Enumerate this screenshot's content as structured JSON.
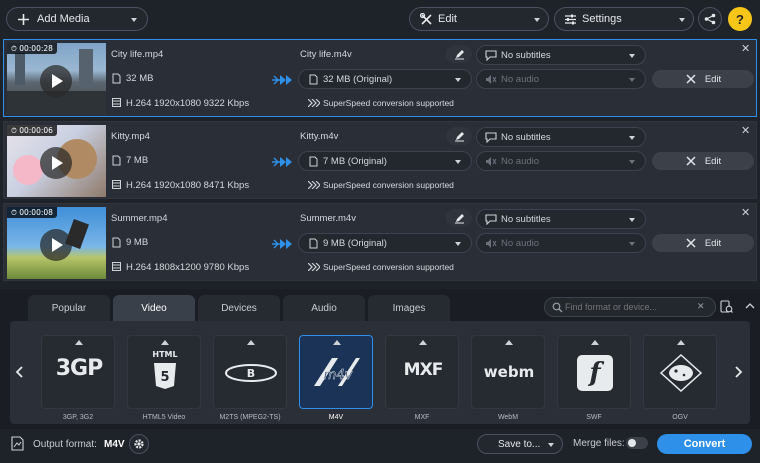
{
  "toolbar": {
    "add_media": "Add Media",
    "edit": "Edit",
    "settings": "Settings",
    "help": "?"
  },
  "files": [
    {
      "duration": "00:00:28",
      "source_name": "City life.mp4",
      "source_size": "32 MB",
      "source_info": "H.264 1920x1080 9322 Kbps",
      "output_name": "City life.m4v",
      "output_size": "32 MB (Original)",
      "superspeed": "SuperSpeed conversion supported",
      "subtitles": "No subtitles",
      "audio": "No audio",
      "edit": "Edit"
    },
    {
      "duration": "00:00:06",
      "source_name": "Kitty.mp4",
      "source_size": "7 MB",
      "source_info": "H.264 1920x1080 8471 Kbps",
      "output_name": "Kitty.m4v",
      "output_size": "7 MB (Original)",
      "superspeed": "SuperSpeed conversion supported",
      "subtitles": "No subtitles",
      "audio": "No audio",
      "edit": "Edit"
    },
    {
      "duration": "00:00:08",
      "source_name": "Summer.mp4",
      "source_size": "9 MB",
      "source_info": "H.264 1808x1200 9780 Kbps",
      "output_name": "Summer.m4v",
      "output_size": "9 MB (Original)",
      "superspeed": "SuperSpeed conversion supported",
      "subtitles": "No subtitles",
      "audio": "No audio",
      "edit": "Edit"
    }
  ],
  "tabs": [
    "Popular",
    "Video",
    "Devices",
    "Audio",
    "Images"
  ],
  "active_tab": "Video",
  "format_search": {
    "placeholder": "Find format or device..."
  },
  "formats": [
    {
      "logo": "3GP",
      "label": "3GP, 3G2"
    },
    {
      "logo": "HTML5",
      "label": "HTML5 Video"
    },
    {
      "logo": "Blu-ray",
      "label": "M2TS (MPEG2-TS)"
    },
    {
      "logo": "m4v",
      "label": "M4V"
    },
    {
      "logo": "MXF",
      "label": "MXF"
    },
    {
      "logo": "webm",
      "label": "WebM"
    },
    {
      "logo": "f",
      "label": "SWF"
    },
    {
      "logo": "OGV",
      "label": "OGV"
    }
  ],
  "selected_format": "M4V",
  "bottom": {
    "output_format_label": "Output format:",
    "output_format_value": "M4V",
    "save_to": "Save to...",
    "merge_files": "Merge files:",
    "convert": "Convert"
  },
  "colors": {
    "accent": "#2e90e8",
    "background": "#1e2229",
    "panel": "#2a2e36"
  }
}
